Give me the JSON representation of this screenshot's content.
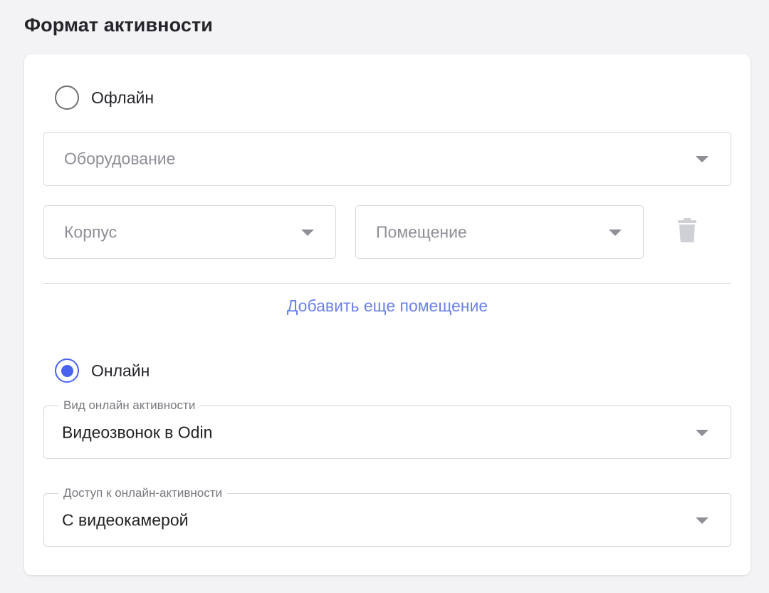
{
  "page_title": "Формат активности",
  "offline": {
    "label": "Офлайн",
    "selected": false,
    "equipment": {
      "placeholder": "Оборудование"
    },
    "building": {
      "placeholder": "Корпус"
    },
    "room": {
      "placeholder": "Помещение"
    },
    "delete_icon": "trash-icon",
    "add_room_label": "Добавить еще помещение"
  },
  "online": {
    "label": "Онлайн",
    "selected": true,
    "activity_type": {
      "label": "Вид онлайн активности",
      "value": "Видеозвонок в Odin"
    },
    "access": {
      "label": "Доступ к онлайн-активности",
      "value": "С видеокамерой"
    }
  },
  "colors": {
    "accent": "#4a63ee",
    "link": "#6b82ea",
    "border": "#d7d7dc",
    "placeholder": "#8e8e96",
    "background": "#f3f3f5"
  }
}
